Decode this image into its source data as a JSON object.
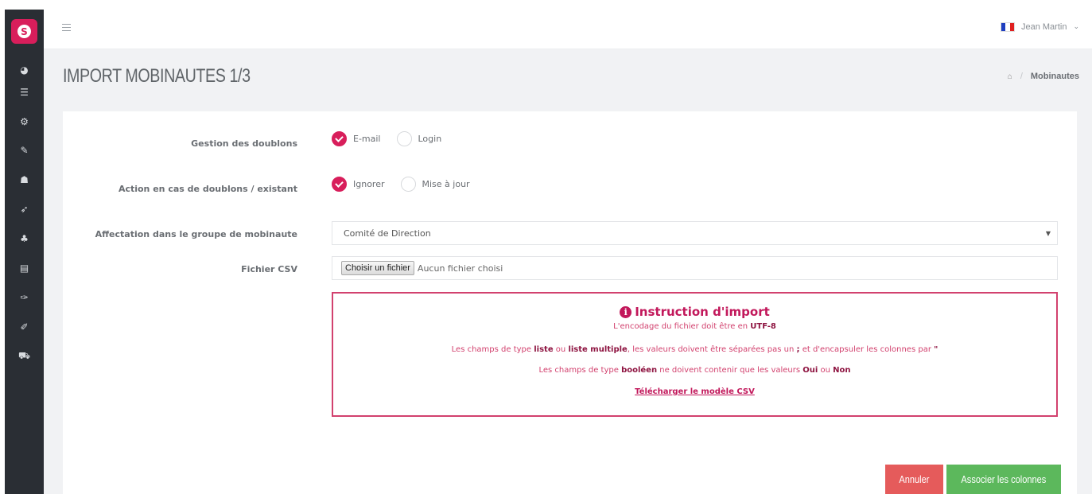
{
  "app": {
    "logo_letter": "S"
  },
  "sidebar": {
    "items": [
      {
        "icon": "dashboard-icon",
        "glyph": "◕"
      },
      {
        "icon": "list-icon",
        "glyph": "☰"
      },
      {
        "icon": "cogs-icon",
        "glyph": "⚙"
      },
      {
        "icon": "edit-icon",
        "glyph": "✎"
      },
      {
        "icon": "users-icon",
        "glyph": "☗"
      },
      {
        "icon": "send-icon",
        "glyph": "➶"
      },
      {
        "icon": "sitemap-icon",
        "glyph": "♣"
      },
      {
        "icon": "card-icon",
        "glyph": "▤"
      },
      {
        "icon": "plug-icon",
        "glyph": "✑"
      },
      {
        "icon": "brush-icon",
        "glyph": "✐"
      },
      {
        "icon": "cart-icon",
        "glyph": "⛟"
      }
    ]
  },
  "topbar": {
    "user_name": "Jean Martin",
    "user_chevron": "⌄",
    "flag_colors": [
      "#1f3fbf",
      "#ffffff",
      "#e02020"
    ]
  },
  "page": {
    "title": "IMPORT MOBINAUTES 1/3",
    "breadcrumb_current": "Mobinautes",
    "breadcrumb_sep": "/"
  },
  "form": {
    "duplicates": {
      "label": "Gestion des doublons",
      "options": [
        {
          "label": "E-mail",
          "checked": true
        },
        {
          "label": "Login",
          "checked": false
        }
      ]
    },
    "action": {
      "label": "Action en cas de doublons / existant",
      "options": [
        {
          "label": "Ignorer",
          "checked": true
        },
        {
          "label": "Mise à jour",
          "checked": false
        }
      ]
    },
    "group": {
      "label": "Affectation dans le groupe de mobinaute",
      "value": "Comité de Direction"
    },
    "csv": {
      "label": "Fichier CSV",
      "button": "Choisir un fichier",
      "status": "Aucun fichier choisi"
    }
  },
  "instructions": {
    "title": "Instruction d'import",
    "line1_pre": "L'encodage du fichier doit être en ",
    "line1_bold": "UTF-8",
    "line2_a": "Les champs de type ",
    "line2_b": "liste",
    "line2_c": " ou ",
    "line2_d": "liste multiple",
    "line2_e": ", les valeurs doivent être séparées pas un ",
    "line2_f": ";",
    "line2_g": " et d'encapsuler les colonnes par ",
    "line2_h": "\"",
    "line3_a": "Les champs de type ",
    "line3_b": "booléen",
    "line3_c": " ne doivent contenir que les valeurs ",
    "line3_d": "Oui",
    "line3_e": " ou ",
    "line3_f": "Non",
    "download_link": "Télécharger le modèle CSV"
  },
  "actions": {
    "cancel": "Annuler",
    "next": "Associer les colonnes"
  },
  "colors": {
    "accent": "#d81e5b",
    "cancel": "#e55b5b",
    "next": "#5cb85c",
    "sidebar": "#2a2e34"
  }
}
